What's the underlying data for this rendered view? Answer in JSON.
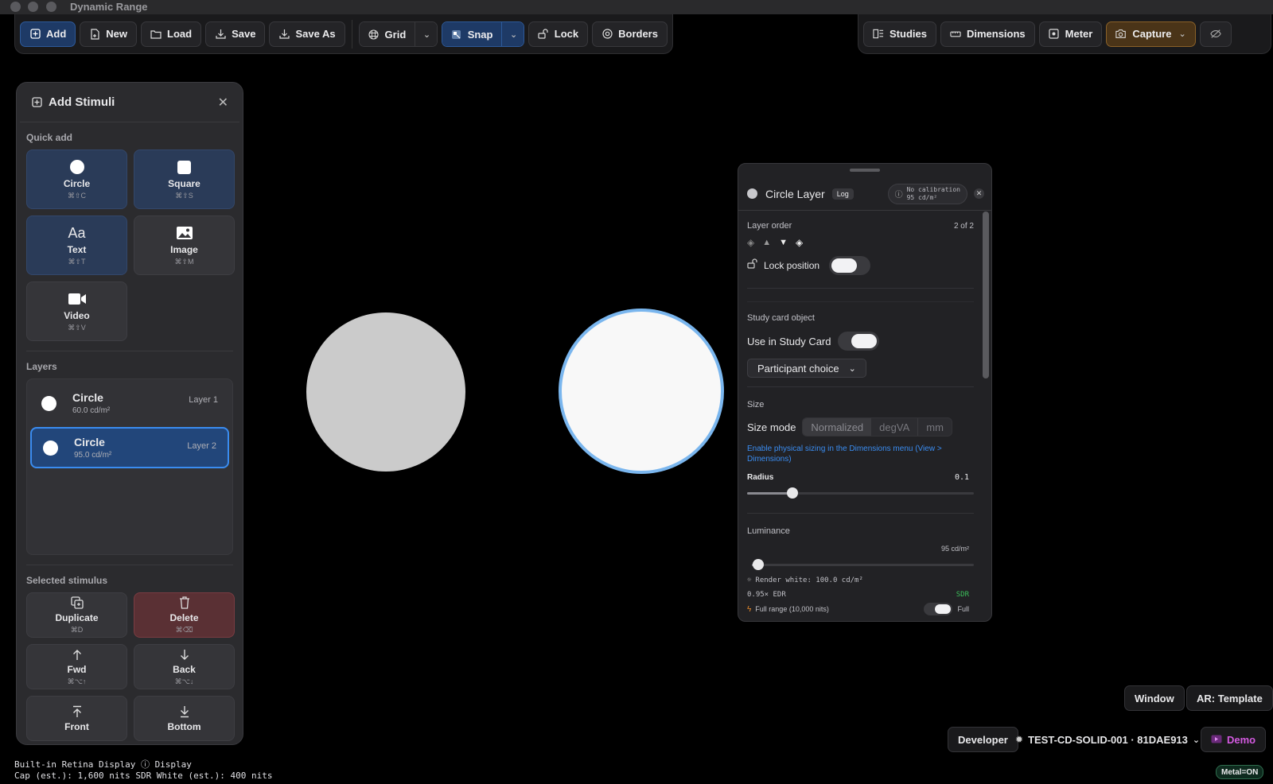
{
  "window": {
    "title": "Dynamic Range"
  },
  "toolbar": {
    "add": "Add",
    "new": "New",
    "load": "Load",
    "save": "Save",
    "save_as": "Save As",
    "grid": "Grid",
    "snap": "Snap",
    "lock": "Lock",
    "borders": "Borders",
    "studies": "Studies",
    "dimensions": "Dimensions",
    "meter": "Meter",
    "capture": "Capture"
  },
  "add_panel": {
    "title": "Add Stimuli",
    "quick_add_label": "Quick add",
    "quick_add": [
      {
        "name": "Circle",
        "shortcut": "⌘⇧C"
      },
      {
        "name": "Square",
        "shortcut": "⌘⇧S"
      },
      {
        "name": "Text",
        "shortcut": "⌘⇧T",
        "glyph": "Aa"
      },
      {
        "name": "Image",
        "shortcut": "⌘⇧M"
      },
      {
        "name": "Video",
        "shortcut": "⌘⇧V"
      }
    ],
    "layers_label": "Layers",
    "layers": [
      {
        "name": "Circle",
        "luminance": "60.0 cd/m²",
        "layer": "Layer 1"
      },
      {
        "name": "Circle",
        "luminance": "95.0 cd/m²",
        "layer": "Layer 2"
      }
    ],
    "selected_label": "Selected stimulus",
    "actions": [
      {
        "name": "Duplicate",
        "shortcut": "⌘D"
      },
      {
        "name": "Delete",
        "shortcut": "⌘⌫"
      },
      {
        "name": "Fwd",
        "shortcut": "⌘⌥↑"
      },
      {
        "name": "Back",
        "shortcut": "⌘⌥↓"
      },
      {
        "name": "Front",
        "shortcut": ""
      },
      {
        "name": "Bottom",
        "shortcut": ""
      }
    ]
  },
  "canvas": {
    "circles": [
      {
        "color": "#cbcbcb"
      },
      {
        "color": "#f8f8f8",
        "outline": "#7ab6ee"
      }
    ]
  },
  "inspector": {
    "title": "Circle Layer",
    "scale_badge": "Log",
    "calibration_line1": "No calibration",
    "calibration_line2": "95 cd/m²",
    "layer_order_label": "Layer order",
    "layer_order_value": "2 of 2",
    "lock_position_label": "Lock position",
    "study_card_section": "Study card object",
    "use_in_study_card_label": "Use in Study Card",
    "participant_choice": "Participant choice",
    "size_section": "Size",
    "size_mode_label": "Size mode",
    "size_modes": [
      "Normalized",
      "degVA",
      "mm"
    ],
    "size_hint": "Enable physical sizing in the Dimensions menu (View > Dimensions)",
    "radius_label": "Radius",
    "radius_value": "0.1",
    "radius_fraction": 0.2,
    "luminance_section": "Luminance",
    "luminance_value": "95 cd/m²",
    "luminance_fraction": 0.03,
    "render_white": "Render white: 100.0 cd/m²",
    "edr": "0.95× EDR",
    "sdr": "SDR",
    "full_range": "Full range (10,000 nits)",
    "full_label": "Full"
  },
  "footer": {
    "window_btn": "Window",
    "ar_btn": "AR: Template",
    "developer_btn": "Developer",
    "test_id": "TEST-CD-SOLID-001 · 81DAE913",
    "demo_btn": "Demo",
    "display_line1": "Built-in Retina Display ⓘ Display",
    "display_line2": "Cap (est.): 1,600 nits  SDR White (est.): 400 nits",
    "metal": "Metal=ON"
  }
}
